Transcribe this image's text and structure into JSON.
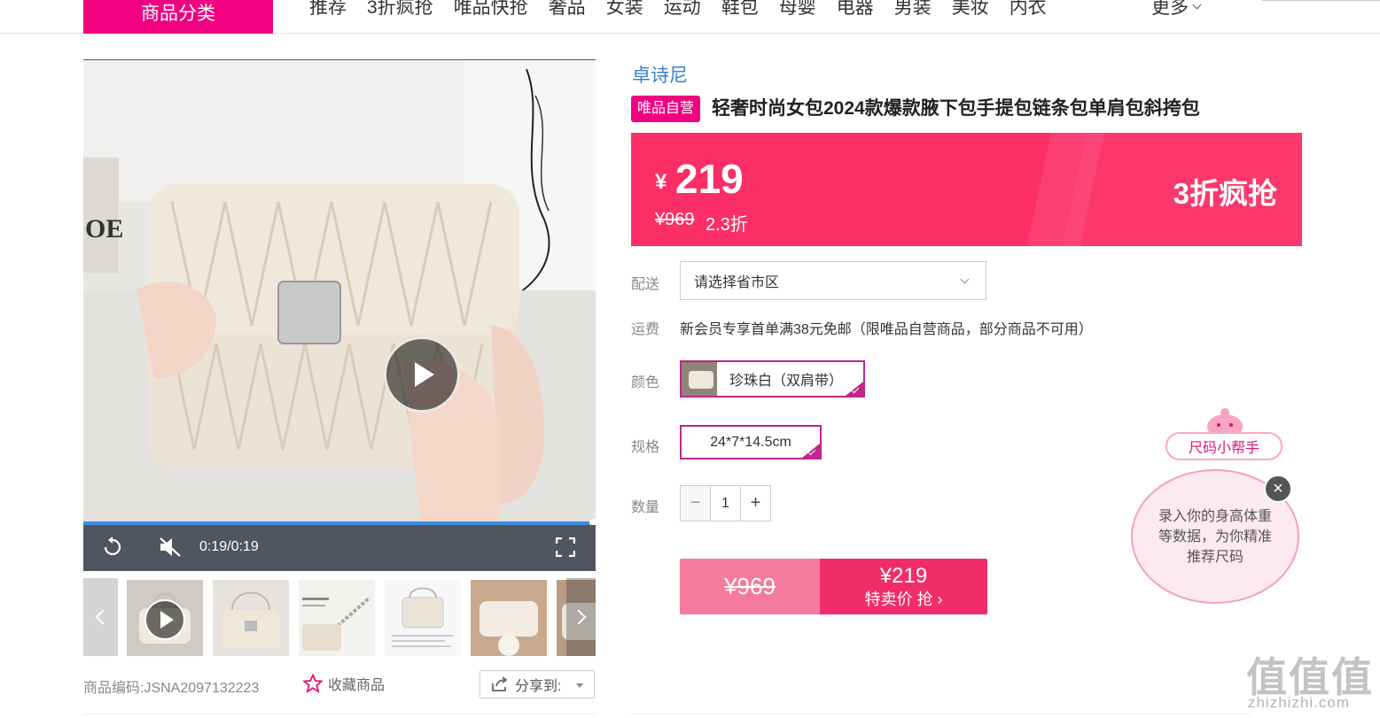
{
  "nav": {
    "category_button": "商品分类",
    "items": [
      "推荐",
      "3折疯抢",
      "唯品快抢",
      "奢品",
      "女装",
      "运动",
      "鞋包",
      "母婴",
      "电器",
      "男装",
      "美妆",
      "内衣"
    ],
    "more": "更多"
  },
  "video": {
    "time": "0:19/0:19",
    "progress": 1.0
  },
  "gallery": {
    "thumb_count": 6
  },
  "product": {
    "code_label": "商品编码:",
    "code": "JSNA2097132223",
    "favorite": "收藏商品",
    "share": "分享到:",
    "brand": "卓诗尼",
    "self_badge": "唯品自营",
    "title": "轻奢时尚女包2024款爆款腋下包手提包链条包单肩包斜挎包"
  },
  "price": {
    "currency": "¥",
    "now": "219",
    "original": "¥969",
    "discount": "2.3折",
    "promo": "3折疯抢"
  },
  "options": {
    "delivery_label": "配送",
    "delivery_placeholder": "请选择省市区",
    "shipping_label": "运费",
    "shipping_text": "新会员专享首单满38元免邮（限唯品自营商品，部分商品不可用）",
    "color_label": "颜色",
    "color_value": "珍珠白（双肩带）",
    "spec_label": "规格",
    "spec_value": "24*7*14.5cm",
    "qty_label": "数量",
    "qty_minus": "−",
    "qty_value": "1",
    "qty_plus": "+"
  },
  "buy": {
    "original": "¥969",
    "price": "¥219",
    "action": "特卖价 抢 ›"
  },
  "helper": {
    "title": "尺码小帮手",
    "text": "录入你的身高体重等数据，为你精准推荐尺码",
    "close": "×"
  },
  "watermark": {
    "big": "值值值",
    "small": "zhizhizhi.com"
  },
  "colors": {
    "brand_pink": "#f10180",
    "banner": "#fb2f66",
    "buy_now": "#f02d6a",
    "buy_orig": "#f47b9d",
    "brand_link": "#3a7fd5"
  }
}
